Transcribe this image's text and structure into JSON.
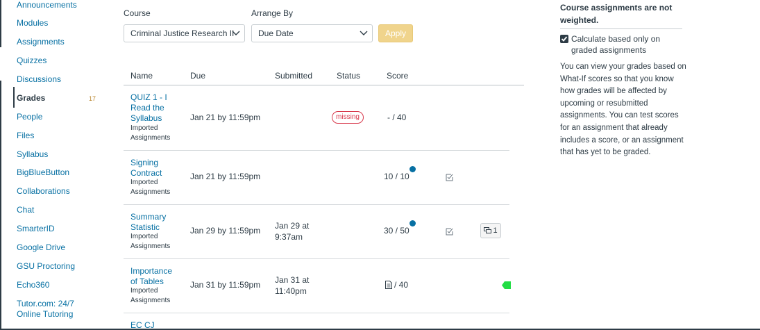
{
  "course_nav": {
    "items": [
      {
        "label": "Announcements"
      },
      {
        "label": "Modules"
      },
      {
        "label": "Assignments"
      },
      {
        "label": "Quizzes"
      },
      {
        "label": "Discussions"
      },
      {
        "label": "Grades",
        "active": true,
        "badge": "17"
      },
      {
        "label": "People"
      },
      {
        "label": "Files"
      },
      {
        "label": "Syllabus"
      },
      {
        "label": "BigBlueButton"
      },
      {
        "label": "Collaborations"
      },
      {
        "label": "Chat"
      },
      {
        "label": "SmarterID"
      },
      {
        "label": "Google Drive"
      },
      {
        "label": "GSU Proctoring"
      },
      {
        "label": "Echo360"
      },
      {
        "label": "Tutor.com: 24/7 Online Tutoring"
      }
    ]
  },
  "controls": {
    "course_label": "Course",
    "course_value": "Criminal Justice Research II",
    "arrange_label": "Arrange By",
    "arrange_value": "Due Date",
    "apply_label": "Apply"
  },
  "table": {
    "headers": {
      "name": "Name",
      "due": "Due",
      "submitted": "Submitted",
      "status": "Status",
      "score": "Score"
    },
    "rows": [
      {
        "title": "QUIZ 1 - I Read the Syllabus",
        "group": "Imported Assignments",
        "due": "Jan 21 by 11:59pm",
        "submitted": "",
        "status": "missing",
        "score": "- / 40"
      },
      {
        "title": "Signing Contract",
        "group": "Imported Assignments",
        "due": "Jan 21 by 11:59pm",
        "submitted": "",
        "status": "",
        "score": "10 / 10"
      },
      {
        "title": "Summary Statistic",
        "group": "Imported Assignments",
        "due": "Jan 29 by 11:59pm",
        "submitted": "Jan 29 at 9:37am",
        "status": "",
        "score": "30 / 50",
        "comments": "1"
      },
      {
        "title": "Importance of Tables",
        "group": "Imported Assignments",
        "due": "Jan 31 by 11:59pm",
        "submitted": "Jan 31 at 11:40pm",
        "status": "",
        "score": "/ 40"
      },
      {
        "title": "EC CJ",
        "group": "",
        "due": "",
        "submitted": "",
        "status": "",
        "score": ""
      }
    ]
  },
  "sidebar": {
    "weight_note": "Course assignments are not weighted.",
    "checkbox_label": "Calculate based only on graded assignments",
    "checkbox_checked": true,
    "whatif_text": "You can view your grades based on What-If scores so that you know how grades will be affected by upcoming or resubmitted assignments. You can test scores for an assignment that already includes a score, or an assignment that has yet to be graded."
  },
  "colors": {
    "link": "#0770a3",
    "missing": "#d8384b",
    "apply_button": "#f0d48c",
    "unread_dot": "#0770a3",
    "flag": "#22dd44"
  }
}
